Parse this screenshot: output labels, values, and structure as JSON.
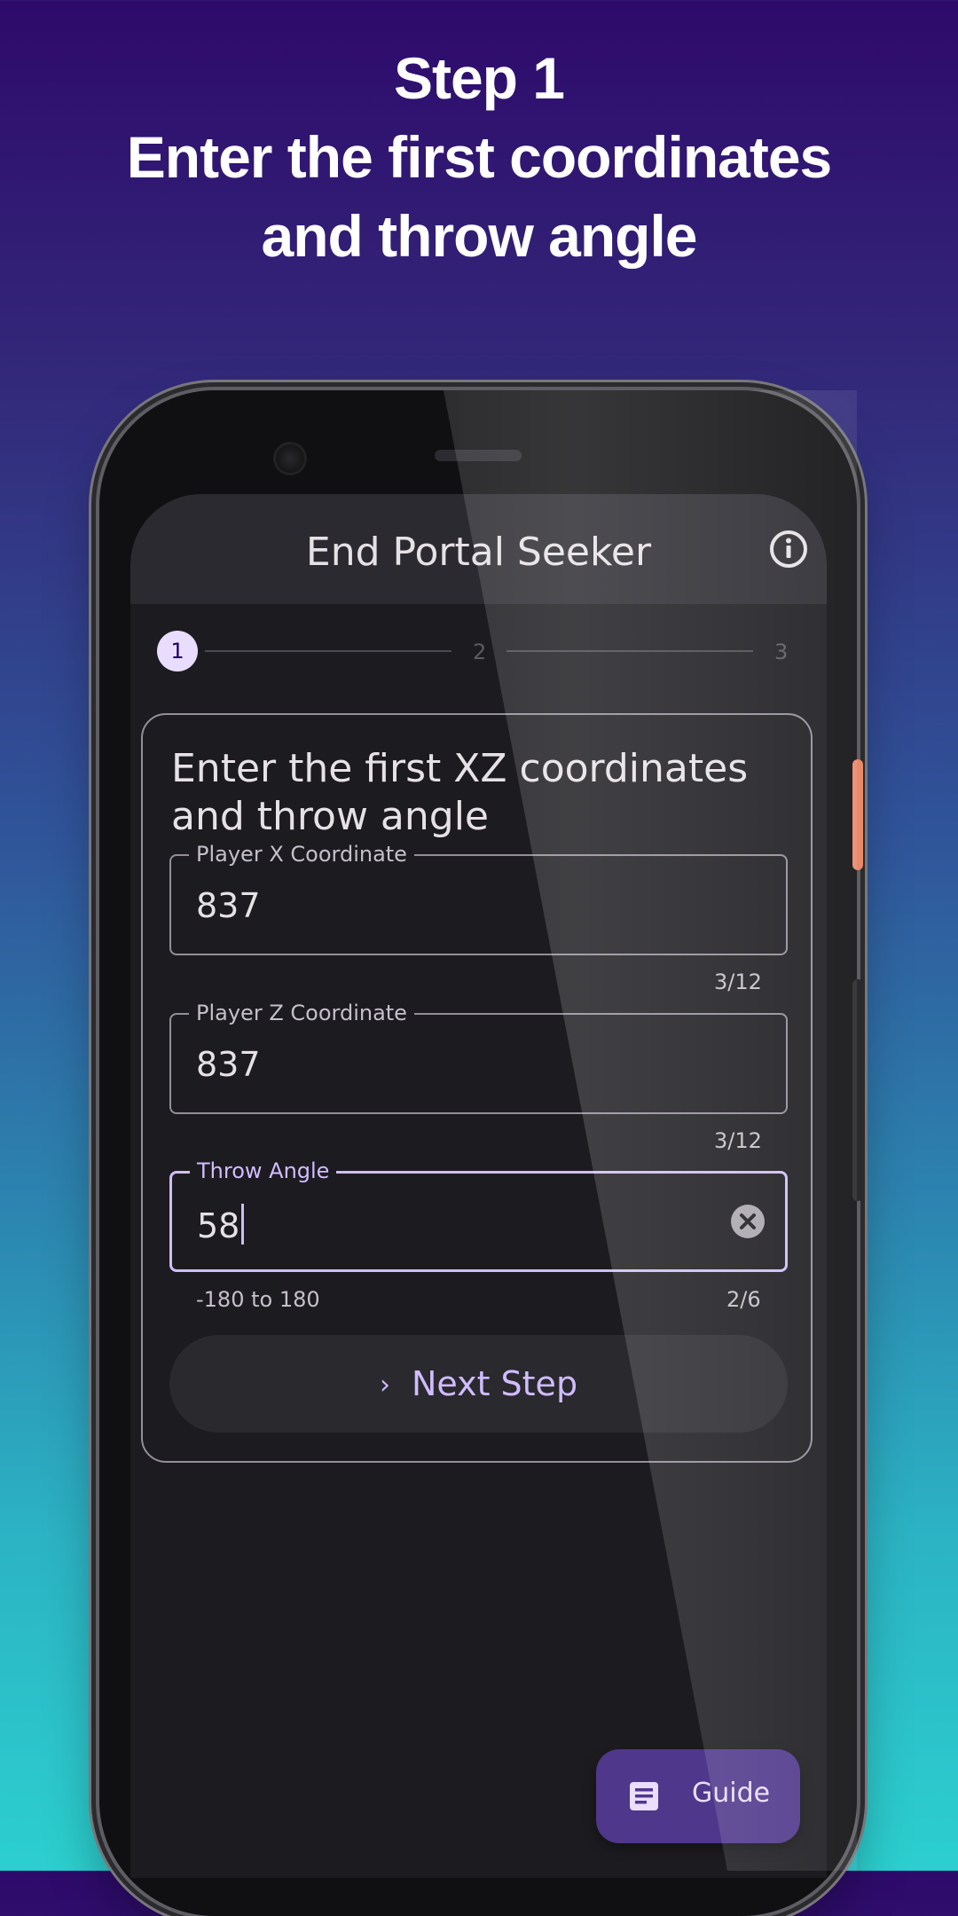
{
  "headline": {
    "line1": "Step 1",
    "line2": "Enter the first coordinates",
    "line3": "and throw angle"
  },
  "app": {
    "title": "End Portal Seeker"
  },
  "stepper": {
    "steps": [
      "1",
      "2",
      "3"
    ],
    "active_index": 0
  },
  "card": {
    "title": "Enter the first XZ coordinates and throw angle",
    "fields": [
      {
        "label": "Player X Coordinate",
        "value": "837",
        "counter": "3/12"
      },
      {
        "label": "Player Z Coordinate",
        "value": "837",
        "counter": "3/12"
      },
      {
        "label": "Throw Angle",
        "value": "58",
        "counter": "2/6",
        "supporting_text": "-180 to 180"
      }
    ],
    "next_button": "Next Step"
  },
  "fab": {
    "label": "Guide"
  },
  "icons": {
    "info": "info-icon",
    "clear": "clear-icon",
    "chevron": "chevron-right-icon",
    "guide": "article-icon"
  },
  "colors": {
    "accent": "#d0bcff",
    "fab_bg": "#4f378b",
    "surface": "#1c1b1f"
  }
}
